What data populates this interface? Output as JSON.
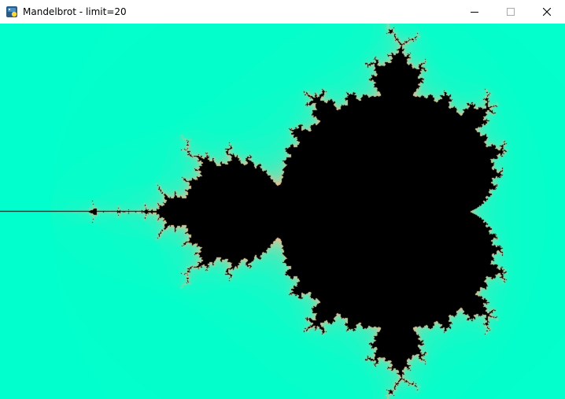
{
  "window": {
    "title": "Mandelbrot - limit=20",
    "icon": "python-icon"
  },
  "controls": {
    "minimize": "minimize-icon",
    "maximize": "maximize-icon",
    "close": "close-icon"
  },
  "fractal": {
    "type": "mandelbrot",
    "limit": 20,
    "colors": {
      "inside": "#000000",
      "outer": "#00ffcc",
      "boundary": "#ff8080"
    }
  }
}
